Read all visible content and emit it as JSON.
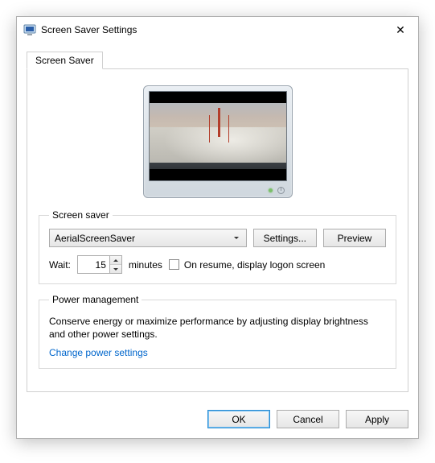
{
  "window": {
    "title": "Screen Saver Settings"
  },
  "tabs": {
    "screensaver": "Screen Saver"
  },
  "group_saver": {
    "legend": "Screen saver",
    "combo_value": "AerialScreenSaver",
    "settings_btn": "Settings...",
    "preview_btn": "Preview",
    "wait_label": "Wait:",
    "wait_value": "15",
    "wait_units": "minutes",
    "resume_label": "On resume, display logon screen",
    "resume_checked": false
  },
  "group_power": {
    "legend": "Power management",
    "text": "Conserve energy or maximize performance by adjusting display brightness and other power settings.",
    "link": "Change power settings"
  },
  "footer": {
    "ok": "OK",
    "cancel": "Cancel",
    "apply": "Apply"
  }
}
